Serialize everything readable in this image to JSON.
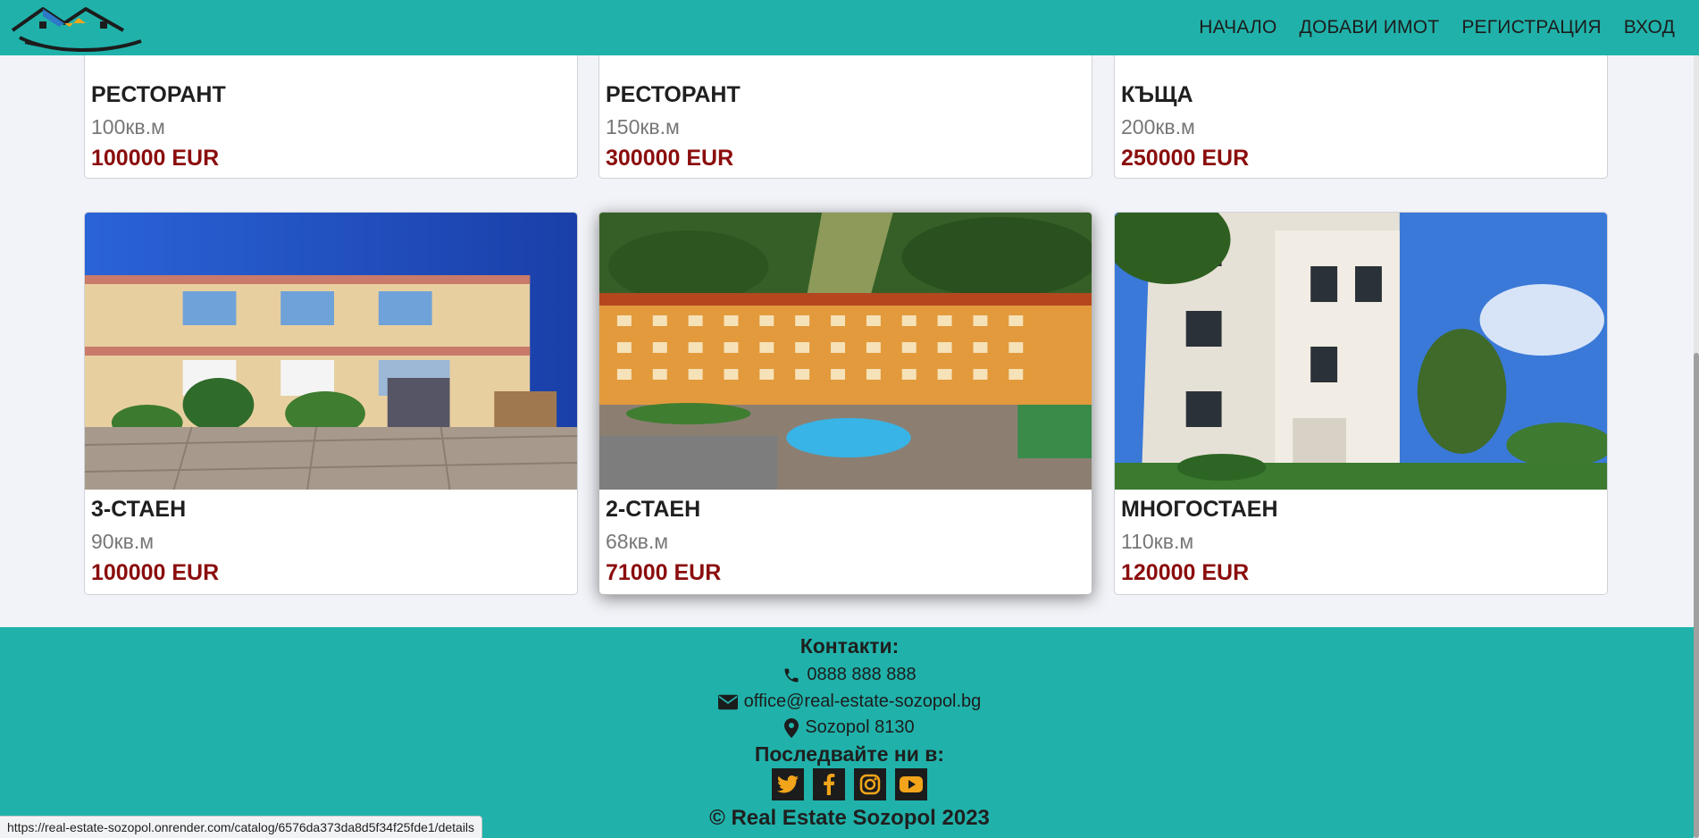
{
  "nav": {
    "links": [
      "НАЧАЛО",
      "ДОБАВИ ИМОТ",
      "РЕГИСТРАЦИЯ",
      "ВХОД"
    ]
  },
  "listings_top": [
    {
      "type": "РЕСТОРАНТ",
      "area": "100кв.м",
      "price": "100000 EUR"
    },
    {
      "type": "РЕСТОРАНТ",
      "area": "150кв.м",
      "price": "300000 EUR"
    },
    {
      "type": "КЪЩА",
      "area": "200кв.м",
      "price": "250000 EUR"
    }
  ],
  "listings_bottom": [
    {
      "type": "3-СТАЕН",
      "area": "90кв.м",
      "price": "100000 EUR"
    },
    {
      "type": "2-СТАЕН",
      "area": "68кв.м",
      "price": "71000 EUR"
    },
    {
      "type": "МНОГОСТАЕН",
      "area": "110кв.м",
      "price": "120000 EUR"
    }
  ],
  "footer": {
    "contacts_title": "Контакти:",
    "phone": "0888 888 888",
    "email": "office@real-estate-sozopol.bg",
    "address": "Sozopol 8130",
    "follow_title": "Последвайте ни в:",
    "social": [
      "twitter-icon",
      "facebook-icon",
      "instagram-icon",
      "youtube-icon"
    ],
    "copyright": "© Real Estate Sozopol 2023"
  },
  "status_url": "https://real-estate-sozopol.onrender.com/catalog/6576da373da8d5f34f25fde1/details",
  "colors": {
    "navbar": "#20b2aa",
    "price": "#8b0d0d",
    "social_bg": "#1c1c1c",
    "social_icon": "#f2a51a"
  }
}
